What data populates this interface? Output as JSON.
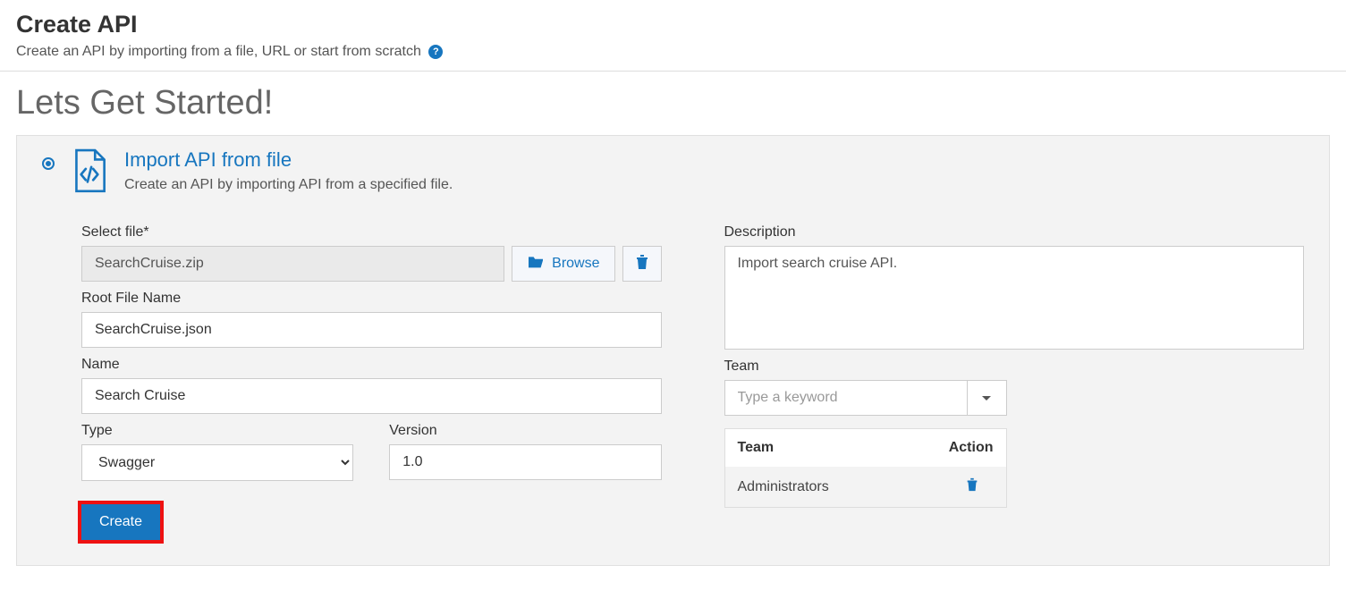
{
  "header": {
    "title": "Create API",
    "subtitle": "Create an API by importing from a file, URL or start from scratch",
    "help_tooltip": "?"
  },
  "lets_heading": "Lets Get Started!",
  "option": {
    "title": "Import API from file",
    "description": "Create an API by importing API from a specified file."
  },
  "form": {
    "select_file_label": "Select file*",
    "file_value": "SearchCruise.zip",
    "browse_label": "Browse",
    "root_file_label": "Root File Name",
    "root_file_value": "SearchCruise.json",
    "name_label": "Name",
    "name_value": "Search Cruise",
    "type_label": "Type",
    "type_value": "Swagger",
    "version_label": "Version",
    "version_value": "1.0",
    "description_label": "Description",
    "description_value": "Import search cruise API.",
    "team_label": "Team",
    "team_placeholder": "Type a keyword",
    "team_table": {
      "col_team": "Team",
      "col_action": "Action",
      "rows": [
        {
          "name": "Administrators"
        }
      ]
    },
    "create_label": "Create"
  }
}
